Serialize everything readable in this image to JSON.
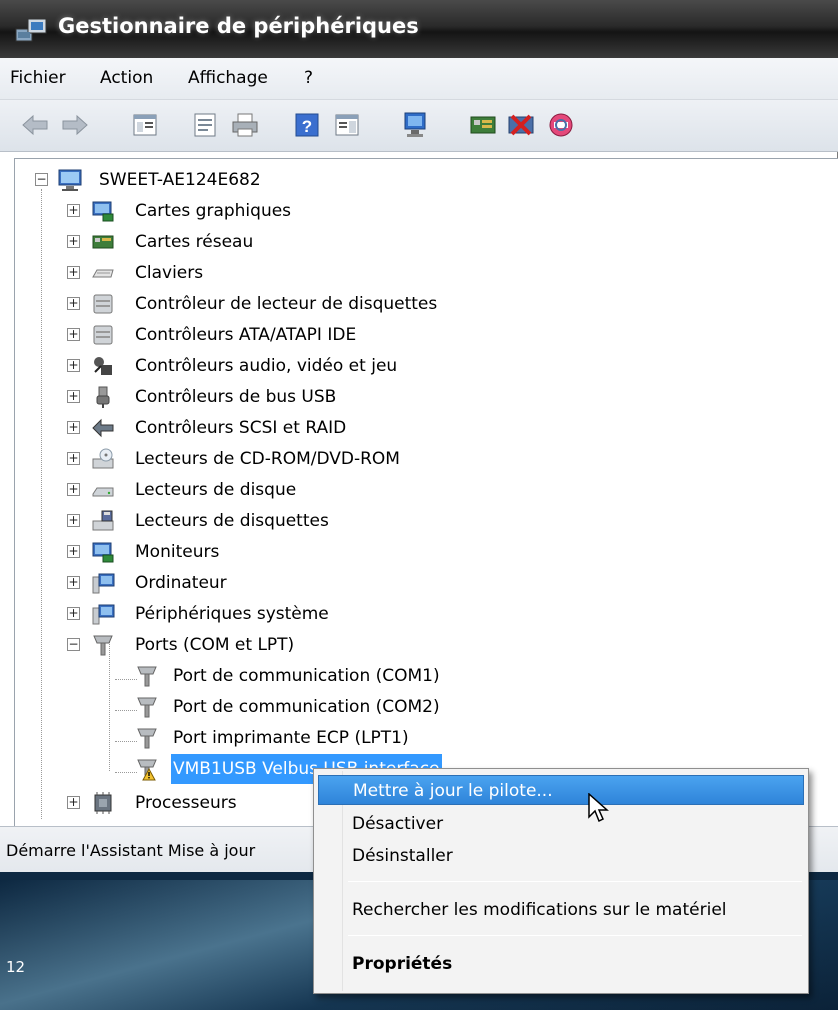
{
  "window": {
    "title": "Gestionnaire de périphériques",
    "title_icon": "device-manager-icon"
  },
  "menubar": {
    "items": [
      "Fichier",
      "Action",
      "Affichage",
      "?"
    ]
  },
  "toolbar": {
    "buttons": [
      "back-arrow-icon",
      "forward-arrow-icon",
      "show-hide-tree-icon",
      "properties-icon",
      "print-icon",
      "help-icon",
      "action-pane-icon",
      "update-driver-icon",
      "scan-hardware-icon",
      "disable-device-icon",
      "uninstall-device-icon"
    ]
  },
  "tree": {
    "root": "SWEET-AE124E682",
    "categories": [
      "Cartes graphiques",
      "Cartes réseau",
      "Claviers",
      "Contrôleur de lecteur de disquettes",
      "Contrôleurs ATA/ATAPI IDE",
      "Contrôleurs audio, vidéo et jeu",
      "Contrôleurs de bus USB",
      "Contrôleurs SCSI et RAID",
      "Lecteurs de CD-ROM/DVD-ROM",
      "Lecteurs de disque",
      "Lecteurs de disquettes",
      "Moniteurs",
      "Ordinateur",
      "Périphériques système",
      "Ports (COM et LPT)"
    ],
    "ports_children": [
      "Port de communication (COM1)",
      "Port de communication (COM2)",
      "Port imprimante ECP (LPT1)",
      "VMB1USB Velbus USB interface"
    ],
    "after": "Processeurs"
  },
  "statusbar": {
    "text": "Démarre l'Assistant Mise à jour"
  },
  "context_menu": {
    "items": [
      "Mettre à jour le pilote...",
      "Désactiver",
      "Désinstaller",
      "Rechercher les modifications sur le matériel",
      "Propriétés"
    ]
  },
  "desktop": {
    "clock_fragment": "12"
  }
}
